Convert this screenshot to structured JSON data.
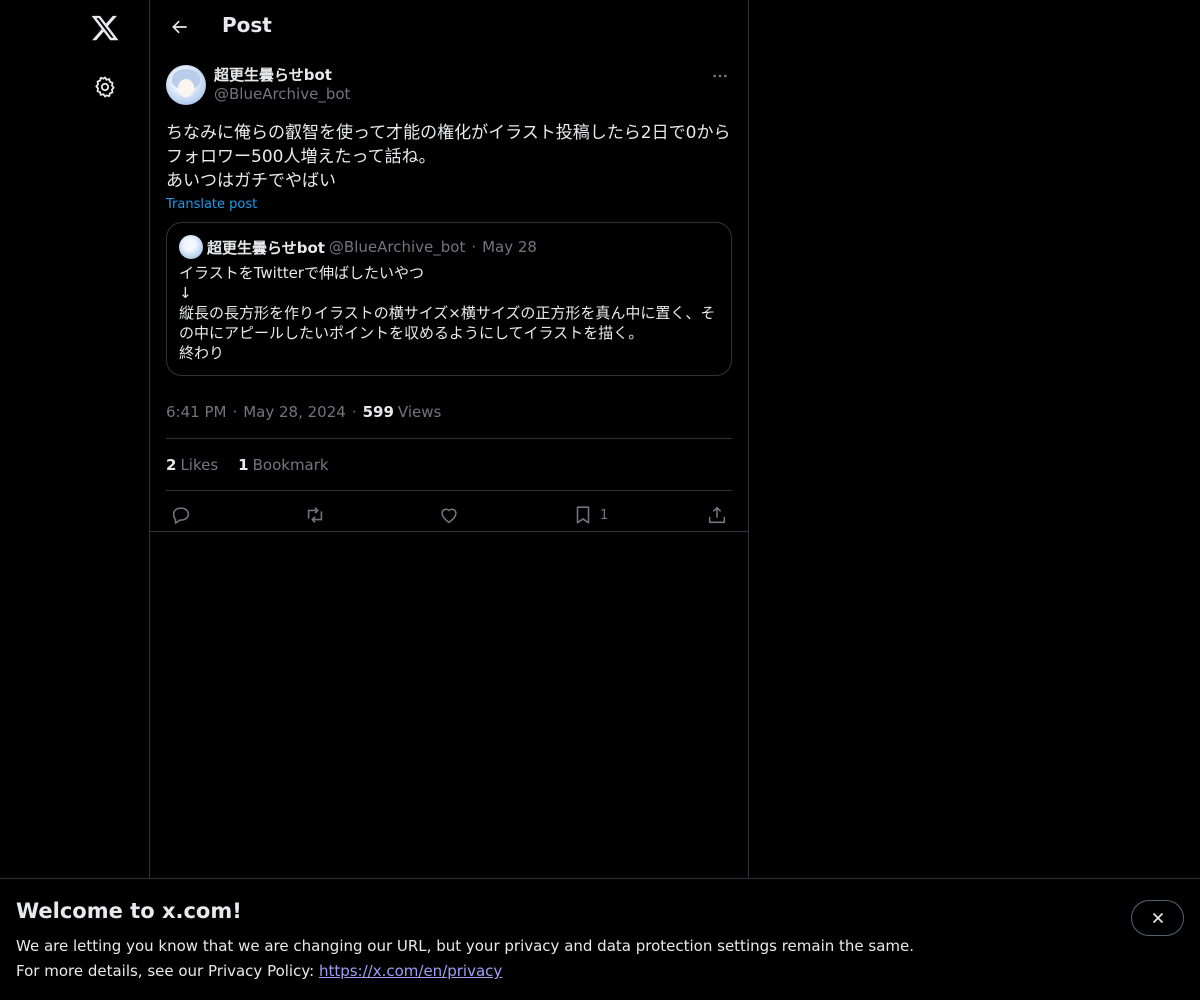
{
  "nav": {
    "logo_icon": "x-logo-icon",
    "settings_icon": "gear-icon"
  },
  "header": {
    "back_icon": "arrow-left-icon",
    "title": "Post"
  },
  "post": {
    "author_name": "超更生曇らせbot",
    "author_handle": "@BlueArchive_bot",
    "text": "ちなみに俺らの叡智を使って才能の権化がイラスト投稿したら2日で0から\nフォロワー500人増えたって話ね。\nあいつはガチでやばい",
    "translate_label": "Translate post",
    "quote": {
      "author_name": "超更生曇らせbot",
      "author_handle": "@BlueArchive_bot",
      "date": "May 28",
      "text": "イラストをTwitterで伸ばしたいやつ\n↓\n縦長の長方形を作りイラストの横サイズ×横サイズの正方形を真ん中に置く、そ\nの中にアピールしたいポイントを収めるようにしてイラストを描く。\n終わり"
    },
    "time": "6:41 PM",
    "date": "May 28, 2024",
    "views_count": "599",
    "views_label": "Views",
    "likes_count": "2",
    "likes_label": "Likes",
    "bookmarks_count": "1",
    "bookmarks_label": "Bookmark",
    "actions": {
      "reply_icon": "reply-icon",
      "repost_icon": "repost-icon",
      "like_icon": "heart-icon",
      "bookmark_icon": "bookmark-icon",
      "bookmark_count": "1",
      "share_icon": "share-icon"
    }
  },
  "banner": {
    "title": "Welcome to x.com!",
    "line1": "We are letting you know that we are changing our URL, but your privacy and data protection settings remain the same.",
    "line2_prefix": "For more details, see our Privacy Policy: ",
    "link": "https://x.com/en/privacy",
    "close_icon": "close-icon"
  },
  "colors": {
    "background": "#000000",
    "text": "#e7e9ea",
    "secondary": "#71767b",
    "border": "#2f3336",
    "accent": "#1d9bf0",
    "link": "#a69bf5"
  }
}
